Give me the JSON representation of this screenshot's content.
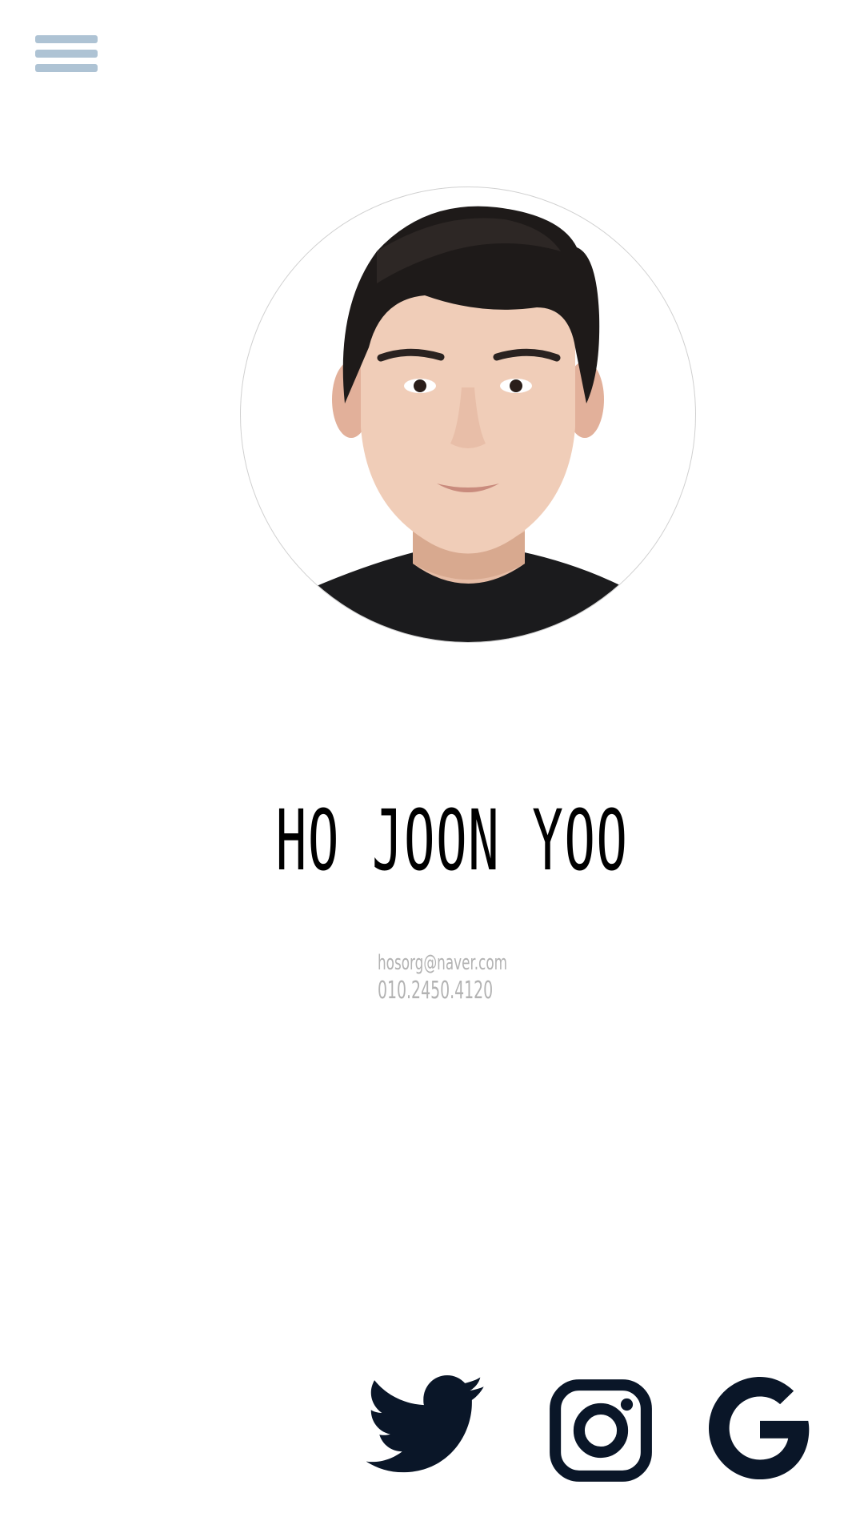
{
  "menu": {
    "icon": "hamburger-menu-icon",
    "color": "#aec3d4"
  },
  "profile": {
    "name": "HO JOON YOO",
    "email": "hosorg@naver.com",
    "phone": "010.2450.4120"
  },
  "social": [
    {
      "icon": "twitter-icon"
    },
    {
      "icon": "instagram-icon"
    },
    {
      "icon": "google-icon"
    }
  ],
  "colors": {
    "social_icon": "#0a1628",
    "contact_text": "#b3b3b3"
  }
}
